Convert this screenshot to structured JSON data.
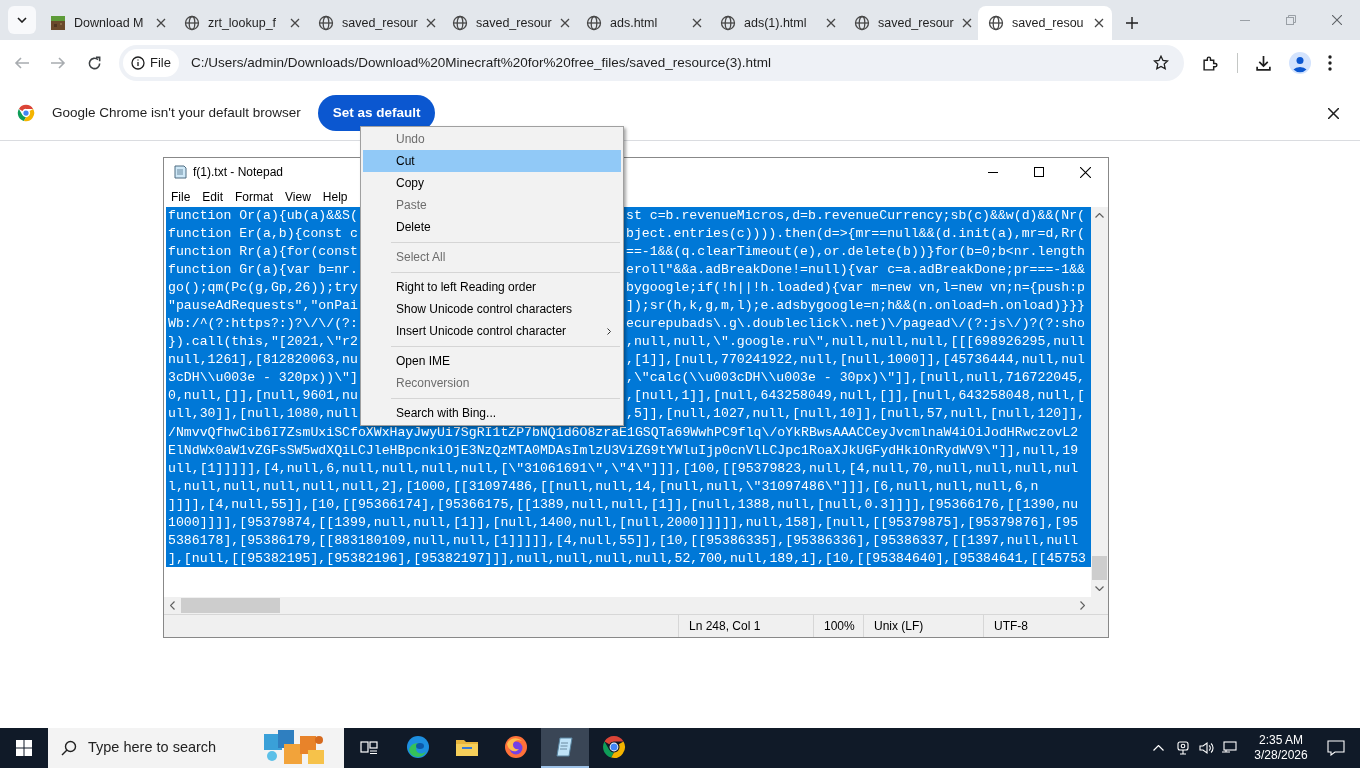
{
  "browser": {
    "tabs": [
      {
        "title": "Download M",
        "kind": "block",
        "selected": false
      },
      {
        "title": "zrt_lookup_f",
        "kind": "globe",
        "selected": false
      },
      {
        "title": "saved_resour",
        "kind": "globe",
        "selected": false
      },
      {
        "title": "saved_resour",
        "kind": "globe",
        "selected": false
      },
      {
        "title": "ads.html",
        "kind": "globe",
        "selected": false
      },
      {
        "title": "ads(1).html",
        "kind": "globe",
        "selected": false
      },
      {
        "title": "saved_resour",
        "kind": "globe",
        "selected": false
      },
      {
        "title": "saved_resou",
        "kind": "globe",
        "selected": true
      }
    ],
    "address": {
      "chip": "File",
      "url": "C:/Users/admin/Downloads/Download%20Minecraft%20for%20free_files/saved_resource(3).html"
    },
    "infobar": {
      "message": "Google Chrome isn't your default browser",
      "button": "Set as default"
    }
  },
  "notepad": {
    "title": "f(1).txt - Notepad",
    "menu": [
      "File",
      "Edit",
      "Format",
      "View",
      "Help"
    ],
    "text_selected": true,
    "lines": [
      {
        "kind": "split",
        "left": "function Or(a){ub(a)&&S(",
        "right": "st c=b.revenueMicros,d=b.revenueCurrency;sb(c)&&w(d)&&(Nr("
      },
      {
        "kind": "split",
        "left": "function Er(a,b){const c",
        "right": "bject.entries(c)))).then(d=>{mr==null&&(d.init(a),mr=d,Rr("
      },
      {
        "kind": "split",
        "left": "function Rr(a){for(const",
        "right": "==-1&&(q.clearTimeout(e),or.delete(b))}for(b=0;b<nr.length"
      },
      {
        "kind": "split",
        "left": "function Gr(a){var b=nr.",
        "right": "eroll\"&&a.adBreakDone!=null){var c=a.adBreakDone;pr===-1&&"
      },
      {
        "kind": "split",
        "left": "go();qm(Pc(g,Gp,26));try",
        "right": "bygoogle;if(!h||!h.loaded){var m=new vn,l=new vn;n={push:p"
      },
      {
        "kind": "split",
        "left": "\"pauseAdRequests\",\"onPai",
        "right": "]);sr(h,k,g,m,l);e.adsbygoogle=n;h&&(n.onload=h.onload)}}}"
      },
      {
        "kind": "split",
        "left": "Wb:/^(?:https?:)?\\/\\/(?:",
        "right": "ecurepubads\\.g\\.doubleclick\\.net)\\/pagead\\/(?:js\\/)?(?:sho"
      },
      {
        "kind": "split",
        "left": "}).call(this,\"[2021,\\\"r2",
        "right": ",null,null,\\\".google.ru\\\",null,null,null,[[[698926295,null"
      },
      {
        "kind": "split",
        "left": "null,1261],[812820063,nu",
        "right": ",[1]],[null,770241922,null,[null,1000]],[45736444,null,nul"
      },
      {
        "kind": "split",
        "left": "3cDH\\\\u003e - 320px))\\\"]",
        "right": ",\\\"calc(\\\\u003cDH\\\\u003e - 30px)\\\"]],[null,null,716722045,"
      },
      {
        "kind": "split",
        "left": "0,null,[]],[null,9601,nu",
        "right": ",[null,1]],[null,643258049,null,[]],[null,643258048,null,["
      },
      {
        "kind": "split",
        "left": "ull,30]],[null,1080,null",
        "right": ",5]],[null,1027,null,[null,10]],[null,57,null,[null,120]],"
      },
      {
        "kind": "full",
        "text": "/NmvvQfhwCib6I7ZsmUxiSCfoXWxHayJwyUi7SgRI1tZP7bNQ1d6O8zraE1GSQTa69WwhPC9flq\\/oYkRBwsAAACCeyJvcmlnaW4iOiJodHRwczovL2"
      },
      {
        "kind": "full",
        "text": "ElNdWx0aW1vZGFsSW5wdXQiLCJleHBpcnkiOjE3NzQzMTA0MDAsImlzU3ViZG9tYWluIjp0cnVlLCJpc1RoaXJkUGFydHkiOnRydWV9\\\"]],null,19"
      },
      {
        "kind": "full",
        "text": "ull,[1]]]]],[4,null,6,null,null,null,null,[\\\"31061691\\\",\\\"4\\\"]]],[100,[[95379823,null,[4,null,70,null,null,null,nul"
      },
      {
        "kind": "full",
        "text": "l,null,null,null,null,null,2],[1000,[[31097486,[[null,null,14,[null,null,\\\"31097486\\\"]]],[6,null,null,null,6,n"
      },
      {
        "kind": "full",
        "text": "]]]],[4,null,55]],[10,[[95366174],[95366175,[[1389,null,null,[1]],[null,1388,null,[null,0.3]]]],[95366176,[[1390,nu"
      },
      {
        "kind": "full",
        "text": "1000]]]],[95379874,[[1399,null,null,[1]],[null,1400,null,[null,2000]]]]],null,158],[null,[[95379875],[95379876],[95"
      },
      {
        "kind": "full",
        "text": "5386178],[95386179,[[883180109,null,null,[1]]]]],[4,null,55]],[10,[[95386335],[95386336],[95386337,[[1397,null,null"
      },
      {
        "kind": "full",
        "text": "],[null,[[95382195],[95382196],[95382197]]],null,null,null,null,52,700,null,189,1],[10,[[95384640],[95384641,[[45753"
      }
    ],
    "status": [
      "Ln 248, Col 1",
      "100%",
      "Unix (LF)",
      "UTF-8"
    ]
  },
  "context_menu": {
    "items": [
      {
        "kind": "item",
        "label": "Undo",
        "disabled": true,
        "selected": false,
        "submenu": false
      },
      {
        "kind": "item",
        "label": "Cut",
        "disabled": false,
        "selected": true,
        "submenu": false
      },
      {
        "kind": "item",
        "label": "Copy",
        "disabled": false,
        "selected": false,
        "submenu": false
      },
      {
        "kind": "item",
        "label": "Paste",
        "disabled": true,
        "selected": false,
        "submenu": false
      },
      {
        "kind": "item",
        "label": "Delete",
        "disabled": false,
        "selected": false,
        "submenu": false
      },
      {
        "kind": "separator"
      },
      {
        "kind": "item",
        "label": "Select All",
        "disabled": true,
        "selected": false,
        "submenu": false
      },
      {
        "kind": "separator"
      },
      {
        "kind": "item",
        "label": "Right to left Reading order",
        "disabled": false,
        "selected": false,
        "submenu": false
      },
      {
        "kind": "item",
        "label": "Show Unicode control characters",
        "disabled": false,
        "selected": false,
        "submenu": false
      },
      {
        "kind": "item",
        "label": "Insert Unicode control character",
        "disabled": false,
        "selected": false,
        "submenu": true
      },
      {
        "kind": "separator"
      },
      {
        "kind": "item",
        "label": "Open IME",
        "disabled": false,
        "selected": false,
        "submenu": false
      },
      {
        "kind": "item",
        "label": "Reconversion",
        "disabled": true,
        "selected": false,
        "submenu": false
      },
      {
        "kind": "separator"
      },
      {
        "kind": "item",
        "label": "Search with Bing...",
        "disabled": false,
        "selected": false,
        "submenu": false
      }
    ]
  },
  "taskbar": {
    "search_placeholder": "Type here to search",
    "apps": [
      {
        "kind": "taskview",
        "active": false
      },
      {
        "kind": "edge",
        "active": false
      },
      {
        "kind": "explorer",
        "active": false
      },
      {
        "kind": "firefox",
        "active": false
      },
      {
        "kind": "notepad",
        "active": true
      },
      {
        "kind": "chrome",
        "active": false
      }
    ],
    "time": "2:35 AM",
    "date": "3/28/2026"
  }
}
